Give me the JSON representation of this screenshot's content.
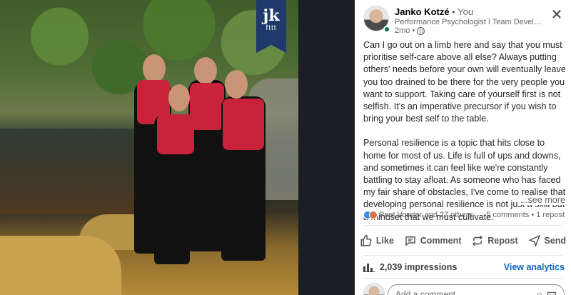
{
  "brand": {
    "logo_text": "jk",
    "logo_sub": "fttt",
    "logo_color": "#1d3a6b"
  },
  "post": {
    "author": "Janko Kotzé",
    "author_suffix": "• You",
    "headline": "Performance Psychologist I Team Development...",
    "time": "2mo •",
    "paragraphs": [
      "Can I go out on a limb here and say that you must prioritise self-care above all else? Always putting others' needs before your own will eventually leave you too drained to be there for the very people you want to support. Taking care of yourself first is not selfish. It's an imperative precursor if you wish to bring your best self to the table.",
      "Personal resilience is a topic that hits close to home for most of us. Life is full of ups and downs, and sometimes it can feel like we're constantly battling to stay afloat. As someone who has faced my fair share of obstacles, I've come to realise that developing personal resilience is not just a skill but a mindset that we must cultivate."
    ],
    "see_more": "...see more"
  },
  "social": {
    "reactors": "Peet Vorster and 27 others",
    "counts": "5 comments • 1 repost",
    "reaction_colors": [
      "#378fe9",
      "#df704d"
    ]
  },
  "actions": [
    {
      "label": "Like",
      "icon": "thumbs-up-icon"
    },
    {
      "label": "Comment",
      "icon": "comment-bubble-icon"
    },
    {
      "label": "Repost",
      "icon": "repost-icon"
    },
    {
      "label": "Send",
      "icon": "send-icon"
    }
  ],
  "impressions": {
    "text": "2,039 impressions",
    "link": "View analytics",
    "icon": "bar-chart-icon"
  },
  "comment": {
    "placeholder": "Add a comment...",
    "icons": "☺ 🖾"
  },
  "colors": {
    "accent": "#0a66c2",
    "online": "#057642",
    "panel_bg": "#ffffff",
    "page_bg": "#1b1f23"
  }
}
